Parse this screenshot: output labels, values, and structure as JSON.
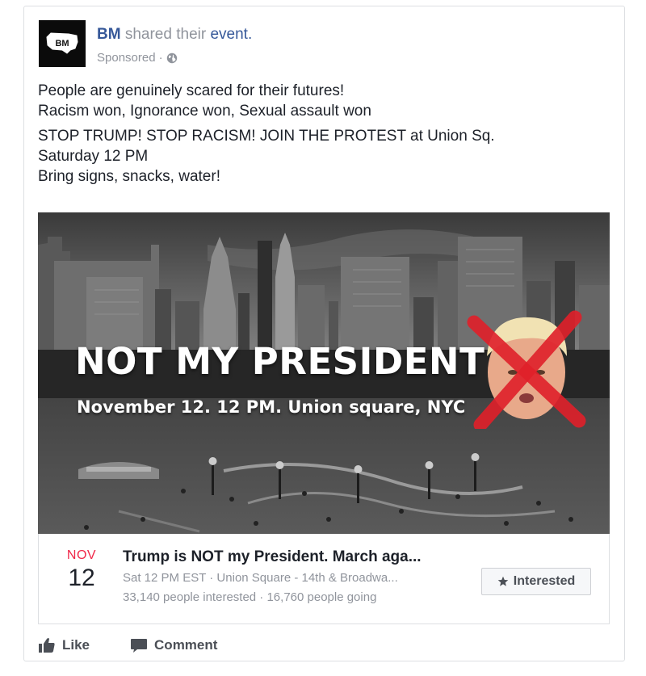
{
  "post": {
    "page_name": "BM",
    "shared_text": "shared their",
    "event_word": "event.",
    "sponsored": "Sponsored",
    "separator": "·",
    "avatar_text": "BM",
    "paragraphs": [
      "People are genuinely scared for their futures!\nRacism won, Ignorance won, Sexual assault won",
      "STOP TRUMP! STOP RACISM! JOIN THE PROTEST at Union Sq.\nSaturday 12 PM\nBring signs, snacks, water!"
    ]
  },
  "media": {
    "headline": "NOT MY PRESIDENT",
    "dateline": "November 12. 12 PM. Union square, NYC"
  },
  "event": {
    "month": "NOV",
    "day": "12",
    "title": "Trump is NOT my President. March aga...",
    "when_where": "Sat 12 PM EST · Union Square - 14th & Broadwa...",
    "stats": "33,140 people interested · 16,760 people going",
    "interested_label": "Interested"
  },
  "actions": {
    "like": "Like",
    "comment": "Comment"
  },
  "colors": {
    "link": "#365899",
    "muted": "#90949c",
    "month_red": "#f02849",
    "cross_red": "#e0202a"
  },
  "icons": [
    "globe-icon",
    "star-icon",
    "thumbs-up-icon",
    "comment-icon"
  ]
}
